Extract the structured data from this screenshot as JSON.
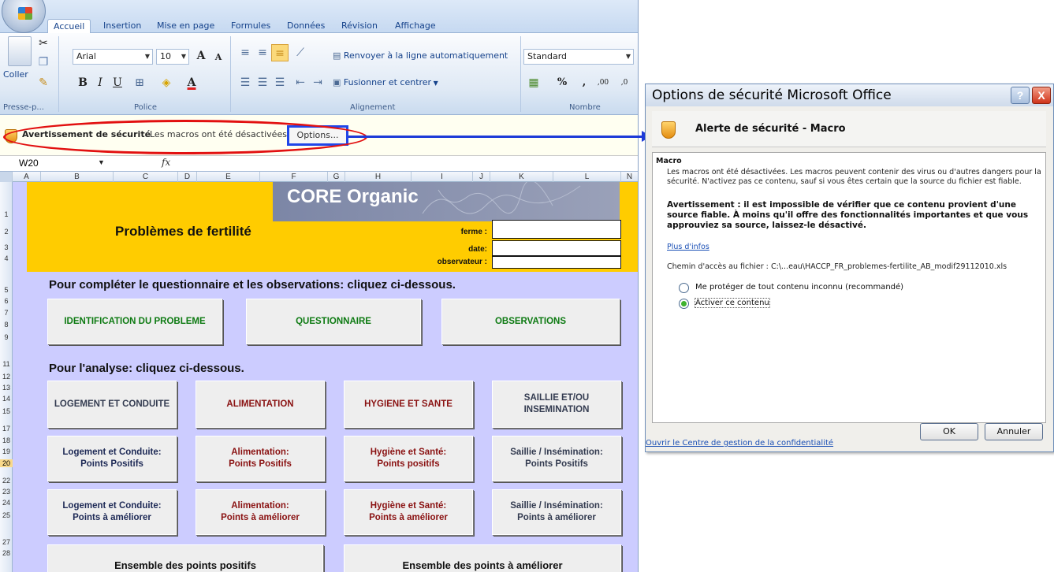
{
  "ribbon": {
    "tabs": [
      "Accueil",
      "Insertion",
      "Mise en page",
      "Formules",
      "Données",
      "Révision",
      "Affichage"
    ],
    "coller_label": "Coller",
    "font_name": "Arial",
    "font_size": "10",
    "wrap_text_label": "Renvoyer à la ligne automatiquement",
    "merge_center_label": "Fusionner et centrer",
    "number_format": "Standard",
    "percent_label": "%",
    "comma_label": ",",
    "dec_inc_label": ",00",
    "dec_dec_label": ",0",
    "group_labels": [
      "Presse-p...",
      "Police",
      "Alignement",
      "Nombre"
    ],
    "bold_label": "B",
    "italic_label": "I",
    "underline_label": "U",
    "font_color_label": "A",
    "grow_font_label": "A",
    "shrink_font_label": "A"
  },
  "message_bar": {
    "title": "Avertissement de sécurité",
    "text": "Les macros ont été désactivées.",
    "options_button": "Options..."
  },
  "formula_bar": {
    "name_box": "W20",
    "fx": "fx"
  },
  "grid": {
    "columns": [
      "A",
      "B",
      "C",
      "D",
      "E",
      "F",
      "G",
      "H",
      "I",
      "J",
      "K",
      "L",
      "N"
    ],
    "rows": [
      "1",
      "2",
      "3",
      "4",
      "5",
      "6",
      "7",
      "8",
      "9",
      "11",
      "12",
      "13",
      "14",
      "15",
      "17",
      "18",
      "19",
      "20",
      "22",
      "23",
      "24",
      "25",
      "27",
      "28"
    ],
    "selected_row": "20"
  },
  "sheet": {
    "banner_title": "CORE Organic",
    "main_title": "Problèmes de fertilité",
    "fields": [
      "ferme :",
      "date:",
      "observateur :"
    ],
    "section1": "Pour compléter le questionnaire et les observations: cliquez ci-dessous.",
    "section2": "Pour l'analyse: cliquez ci-dessous.",
    "top_buttons": [
      "IDENTIFICATION DU PROBLEME",
      "QUESTIONNAIRE",
      "OBSERVATIONS"
    ],
    "analysis_row1": [
      "LOGEMENT ET CONDUITE",
      "ALIMENTATION",
      "HYGIENE ET SANTE",
      "SAILLIE ET/OU INSEMINATION"
    ],
    "analysis_row2": [
      {
        "line1": "Logement et Conduite:",
        "line2": "Points Positifs"
      },
      {
        "line1": "Alimentation:",
        "line2": "Points Positifs"
      },
      {
        "line1": "Hygiène et Santé:",
        "line2": "Points positifs"
      },
      {
        "line1": "Saillie / Insémination:",
        "line2": "Points Positifs"
      }
    ],
    "analysis_row3": [
      {
        "line1": "Logement et Conduite:",
        "line2": "Points à améliorer"
      },
      {
        "line1": "Alimentation:",
        "line2": "Points à améliorer"
      },
      {
        "line1": "Hygiène et Santé:",
        "line2": "Points à améliorer"
      },
      {
        "line1": "Saillie / Insémination:",
        "line2": "Points à améliorer"
      }
    ],
    "bottom_buttons": [
      "Ensemble des points positifs",
      "Ensemble des points à améliorer"
    ]
  },
  "dialog": {
    "title": "Options de sécurité Microsoft Office",
    "help": "?",
    "close": "X",
    "heading": "Alerte de sécurité - Macro",
    "section": "Macro",
    "para1": "Les macros ont été désactivées. Les macros peuvent contenir des virus ou d'autres dangers pour la sécurité. N'activez pas ce contenu, sauf si vous êtes certain que la source du fichier est fiable.",
    "para2": "Avertissement : il est impossible de vérifier que ce contenu provient d'une source fiable. À moins qu'il offre des fonctionnalités importantes et que vous approuviez sa source, laissez-le désactivé.",
    "more_info": "Plus d'infos",
    "path_label": "Chemin d'accès au fichier :",
    "path_value": "C:\\...eau\\HACCP_FR_problemes-fertilite_AB_modif29112010.xls",
    "option1": "Me protéger de tout contenu inconnu (recommandé)",
    "option2": "Activer ce contenu",
    "selected_option": 2,
    "trust_center_link": "Ouvrir le Centre de gestion de la confidentialité",
    "ok": "OK",
    "cancel": "Annuler"
  },
  "colors": {
    "sheet_bg": "#ccccff",
    "header_yellow": "#ffcc00",
    "highlight_red": "#e21010",
    "highlight_blue": "#1d3ad8"
  }
}
